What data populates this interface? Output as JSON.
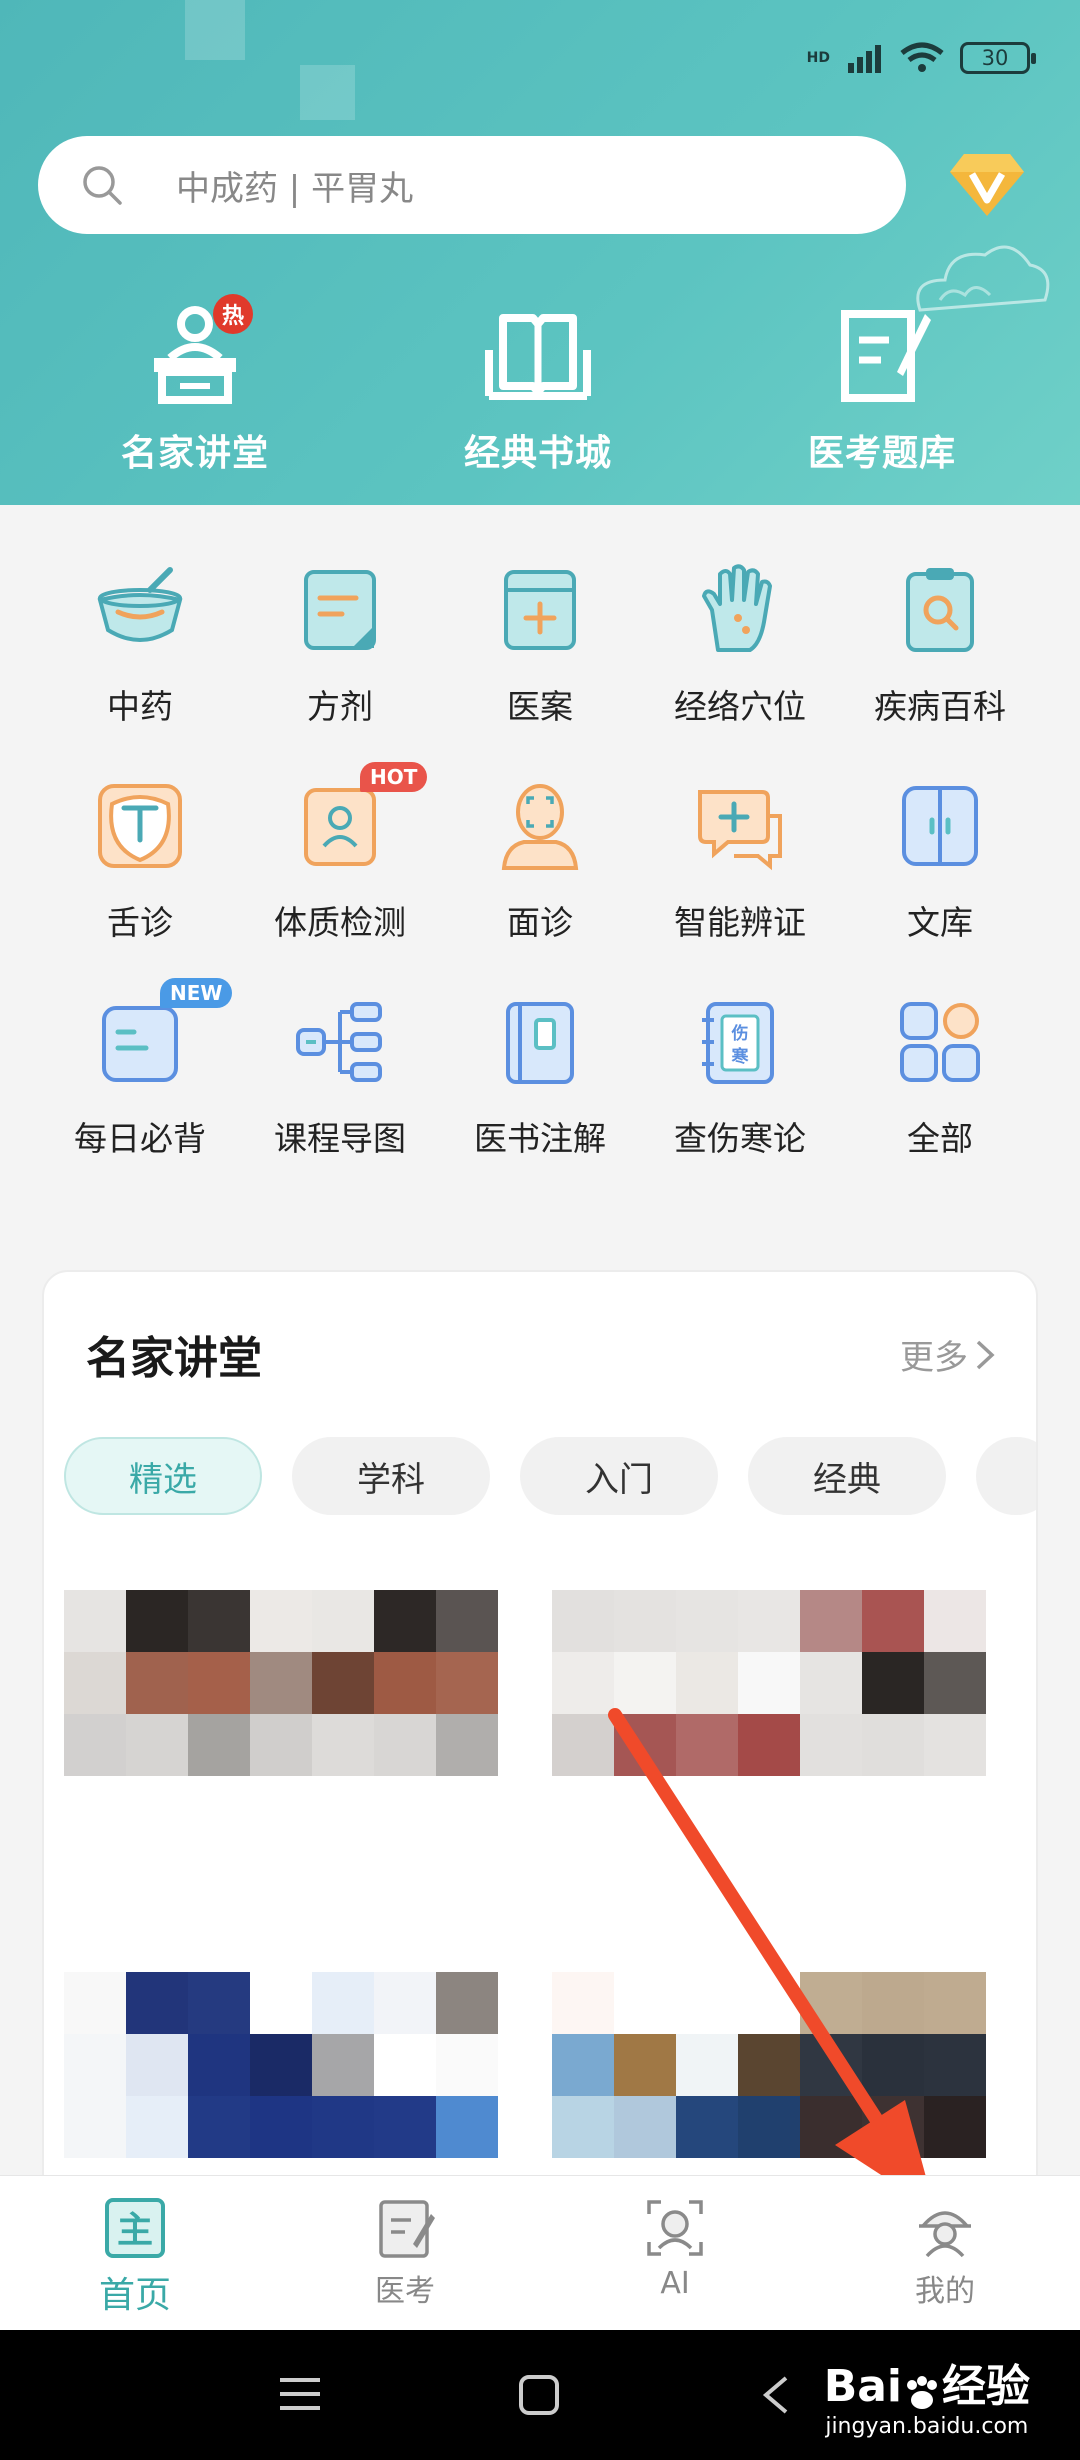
{
  "status_bar": {
    "network": "HD",
    "battery": "30"
  },
  "search": {
    "placeholder": "中成药 | 平胃丸"
  },
  "top_categories": [
    {
      "label": "名家讲堂",
      "badge": "热"
    },
    {
      "label": "经典书城"
    },
    {
      "label": "医考题库"
    }
  ],
  "grid": [
    {
      "label": "中药"
    },
    {
      "label": "方剂"
    },
    {
      "label": "医案"
    },
    {
      "label": "经络穴位"
    },
    {
      "label": "疾病百科"
    },
    {
      "label": "舌诊"
    },
    {
      "label": "体质检测",
      "badge": "HOT"
    },
    {
      "label": "面诊"
    },
    {
      "label": "智能辨证"
    },
    {
      "label": "文库"
    },
    {
      "label": "每日必背",
      "badge": "NEW"
    },
    {
      "label": "课程导图"
    },
    {
      "label": "医书注解"
    },
    {
      "label": "查伤寒论",
      "icon_text": "伤寒"
    },
    {
      "label": "全部"
    }
  ],
  "lecture_card": {
    "title": "名家讲堂",
    "more": "更多",
    "chips": [
      "精选",
      "学科",
      "入门",
      "经典"
    ],
    "active_chip": "精选"
  },
  "tabbar": [
    {
      "label": "首页",
      "icon_text": "主",
      "active": true
    },
    {
      "label": "医考"
    },
    {
      "label": "AI"
    },
    {
      "label": "我的"
    }
  ],
  "watermark": {
    "brand": "Bai",
    "brand_cn": "经验",
    "url": "jingyan.baidu.com"
  },
  "colors": {
    "accent": "#3aa9a7",
    "header": "#5cc4c1",
    "icon_orange": "#f0a35c",
    "icon_teal": "#5bbfc4",
    "arrow": "#f04a2a"
  }
}
